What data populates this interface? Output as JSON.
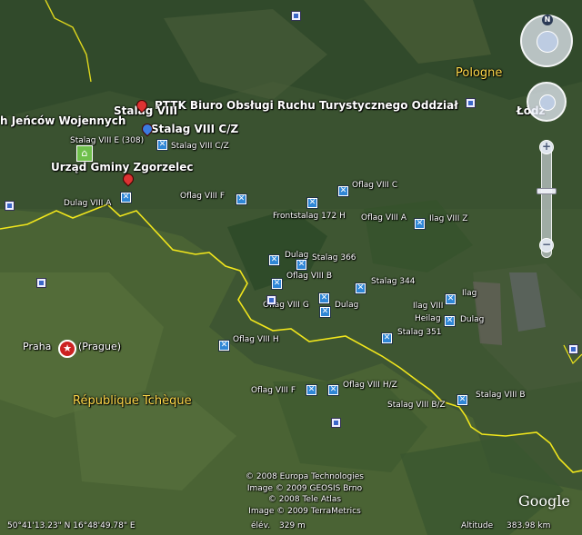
{
  "country_labels": {
    "poland": "Pologne",
    "czech": "République Tchèque",
    "lodz": "Łódź"
  },
  "city": {
    "name": "Praha",
    "alt": "(Prague)"
  },
  "top_labels": {
    "pttk": "PTTK Biuro Obsługi Ruchu Turystycznego Oddział",
    "stalag_viii": "Stalag VIII",
    "stalag_viii_cz_big": "Stalag VIII C/Z",
    "jency": "h Jeńców Wojennych",
    "stalag_viii_e": "Stalag VIII E (308)",
    "stalag_viii_cz": "Stalag VIII C/Z",
    "urzad": "Urząd Gminy Zgorzelec",
    "dulag_viii_a": "Dulag VIII A"
  },
  "markers": {
    "oflag_viii_f_top": "Oflag VIII F",
    "oflag_viii_c": "Oflag VIII C",
    "frontstalag": "Frontstalag 172 H",
    "oflag_viii_a": "Oflag VIII A",
    "ilag_viii_z": "Ilag VIII Z",
    "dulag_1": "Dulag",
    "stalag_366": "Stalag 366",
    "oflag_viii_b": "Oflag VIII B",
    "stalag_344": "Stalag 344",
    "ilag_1": "Ilag",
    "ilag_viii": "Ilag VIII",
    "oflag_viii_g": "Oflag VIII G",
    "dulag_2": "Dulag",
    "heilag": "Heilag",
    "dulag_3": "Dulag",
    "stalag_351": "Stalag 351",
    "oflag_viii_h": "Oflag VIII H",
    "oflag_viii_f_bottom": "Oflag VIII F",
    "oflag_viii_hz": "Oflag VIII H/Z",
    "stalag_viii_b": "Stalag VIII B",
    "stalag_viii_bz": "Stalag VIII B/Z"
  },
  "credits": {
    "line1": "© 2008 Europa Technologies",
    "line2": "Image © 2009 GEOSIS Brno",
    "line3": "© 2008 Tele Atlas",
    "line4": "Image © 2009 TerraMetrics"
  },
  "logo": "Google",
  "status": {
    "coords": "50°41'13.23\" N    16°48'49.78\" E",
    "elev_label": "élév.",
    "elev_value": "329 m",
    "altitude_label": "Altitude",
    "altitude_value": "383.98 km"
  },
  "nav": {
    "north": "N",
    "zoom_in": "+",
    "zoom_out": "−",
    "zoom_level": 0.42
  },
  "colors": {
    "border": "#f1e61c",
    "label": "#ffffff",
    "country_label": "#ffd84a",
    "marker": "#2f86d6"
  }
}
